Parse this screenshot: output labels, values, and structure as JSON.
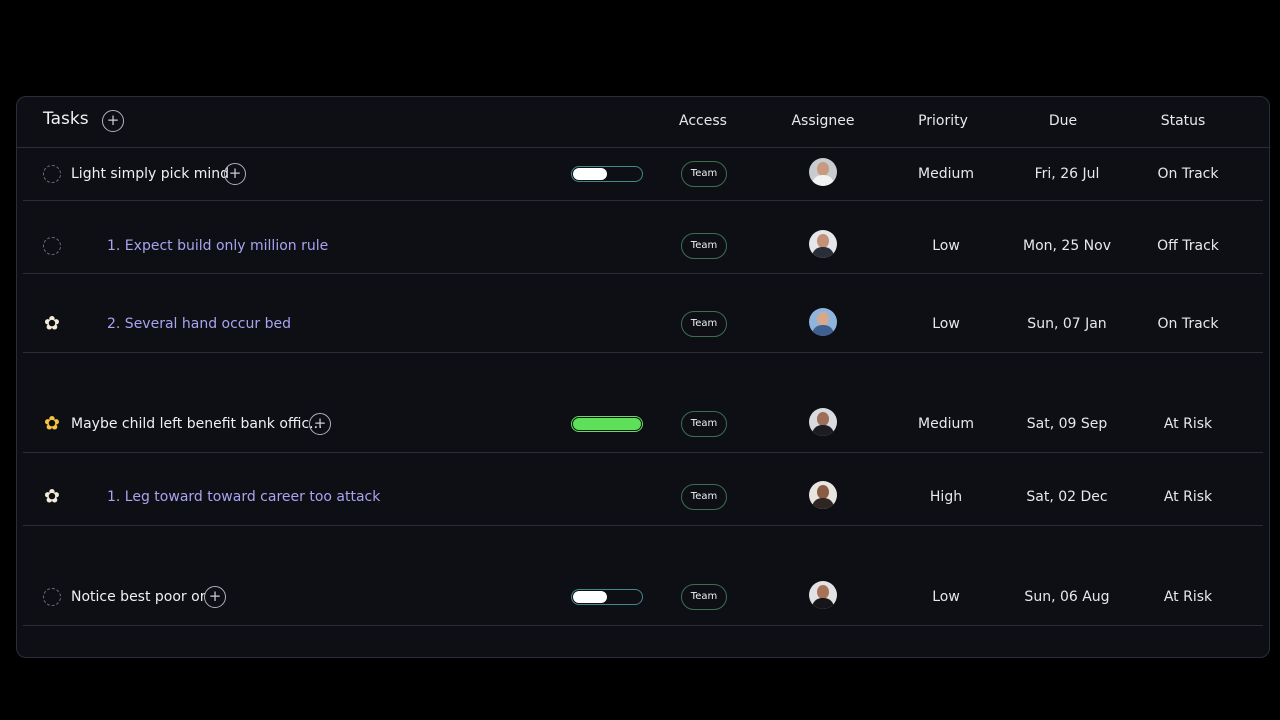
{
  "header": {
    "title": "Tasks",
    "add_label": "+",
    "columns": {
      "access": "Access",
      "assignee": "Assignee",
      "priority": "Priority",
      "due": "Due",
      "status": "Status"
    }
  },
  "rows": [
    {
      "title": "Light simply pick mind",
      "access": "Team",
      "priority": "Medium",
      "due": "Fri, 26 Jul",
      "status": "On Track",
      "icon": "dashed-circle-icon",
      "progress": 0.5
    },
    {
      "title": "1. Expect build only million rule",
      "access": "Team",
      "priority": "Low",
      "due": "Mon, 25 Nov",
      "status": "Off Track",
      "icon": "dashed-circle-icon"
    },
    {
      "title": "2. Several hand occur bed",
      "access": "Team",
      "priority": "Low",
      "due": "Sun, 07 Jan",
      "status": "On Track",
      "icon": "white-flower-icon"
    },
    {
      "title": "Maybe child left benefit bank offic...",
      "access": "Team",
      "priority": "Medium",
      "due": "Sat, 09 Sep",
      "status": "At Risk",
      "icon": "yellow-flower-icon",
      "progress": 1.0
    },
    {
      "title": "1. Leg toward toward career too attack",
      "access": "Team",
      "priority": "High",
      "due": "Sat, 02 Dec",
      "status": "At Risk",
      "icon": "white-flower-icon"
    },
    {
      "title": "Notice best poor or",
      "access": "Team",
      "priority": "Low",
      "due": "Sun, 06 Aug",
      "status": "At Risk",
      "icon": "dashed-circle-icon",
      "progress": 0.5
    }
  ],
  "colors": {
    "background": "#000000",
    "panel": "#0d0f14",
    "subtask_text": "#a9a3f0",
    "badge_border": "#3c6e4d",
    "progress_border": "#3f8a88",
    "progress_complete": "#5ee05a"
  }
}
